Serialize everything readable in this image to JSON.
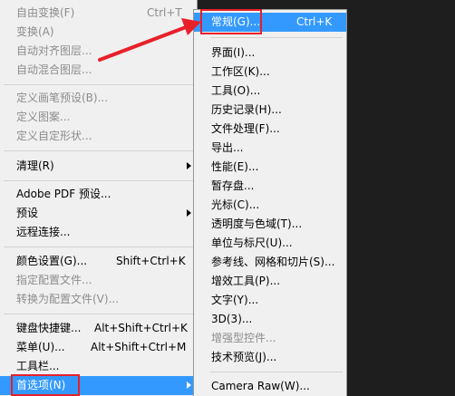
{
  "main_menu": {
    "items": [
      {
        "label": "自由变换(F)",
        "shortcut": "Ctrl+T"
      },
      {
        "label": "变换(A)"
      },
      {
        "label": "自动对齐图层..."
      },
      {
        "label": "自动混合图层..."
      },
      {
        "label": "定义画笔预设(B)..."
      },
      {
        "label": "定义图案..."
      },
      {
        "label": "定义自定形状..."
      },
      {
        "label": "清理(R)"
      },
      {
        "label": "Adobe PDF 预设..."
      },
      {
        "label": "预设"
      },
      {
        "label": "远程连接..."
      },
      {
        "label": "颜色设置(G)...",
        "shortcut": "Shift+Ctrl+K"
      },
      {
        "label": "指定配置文件..."
      },
      {
        "label": "转换为配置文件(V)..."
      },
      {
        "label": "键盘快捷键...",
        "shortcut": "Alt+Shift+Ctrl+K"
      },
      {
        "label": "菜单(U)...",
        "shortcut": "Alt+Shift+Ctrl+M"
      },
      {
        "label": "工具栏..."
      },
      {
        "label": "首选项(N)"
      }
    ]
  },
  "sub_menu": {
    "items": [
      {
        "label": "常规(G)...",
        "shortcut": "Ctrl+K"
      },
      {
        "label": "界面(I)..."
      },
      {
        "label": "工作区(K)..."
      },
      {
        "label": "工具(O)..."
      },
      {
        "label": "历史记录(H)..."
      },
      {
        "label": "文件处理(F)..."
      },
      {
        "label": "导出..."
      },
      {
        "label": "性能(E)..."
      },
      {
        "label": "暂存盘..."
      },
      {
        "label": "光标(C)..."
      },
      {
        "label": "透明度与色域(T)..."
      },
      {
        "label": "单位与标尺(U)..."
      },
      {
        "label": "参考线、网格和切片(S)..."
      },
      {
        "label": "增效工具(P)..."
      },
      {
        "label": "文字(Y)..."
      },
      {
        "label": "3D(3)..."
      },
      {
        "label": "增强型控件..."
      },
      {
        "label": "技术预览(J)..."
      },
      {
        "label": "Camera Raw(W)..."
      }
    ]
  },
  "colors": {
    "highlight": "#3399ff",
    "annotation": "#e8202a",
    "disabled_text": "#8c8c8c"
  }
}
